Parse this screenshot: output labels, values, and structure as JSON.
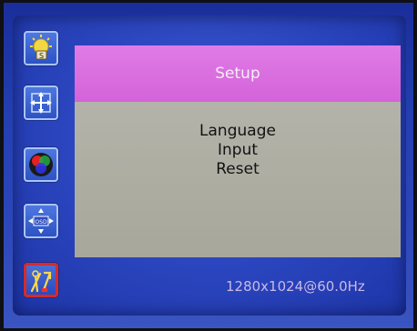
{
  "sidebar": {
    "items": [
      {
        "icon": "brightness-icon",
        "selected": false
      },
      {
        "icon": "position-icon",
        "selected": false
      },
      {
        "icon": "color-icon",
        "selected": false
      },
      {
        "icon": "osd-position-icon",
        "selected": false
      },
      {
        "icon": "setup-tools-icon",
        "selected": true
      }
    ]
  },
  "panel": {
    "title": "Setup",
    "items": [
      "Language",
      "Input",
      "Reset"
    ]
  },
  "status": {
    "resolution": "1280x1024@60.0Hz"
  },
  "colors": {
    "header": "#d463d9",
    "body": "#b4b3a9",
    "background": "#2a44bd",
    "selection_border": "#d82a2a"
  }
}
